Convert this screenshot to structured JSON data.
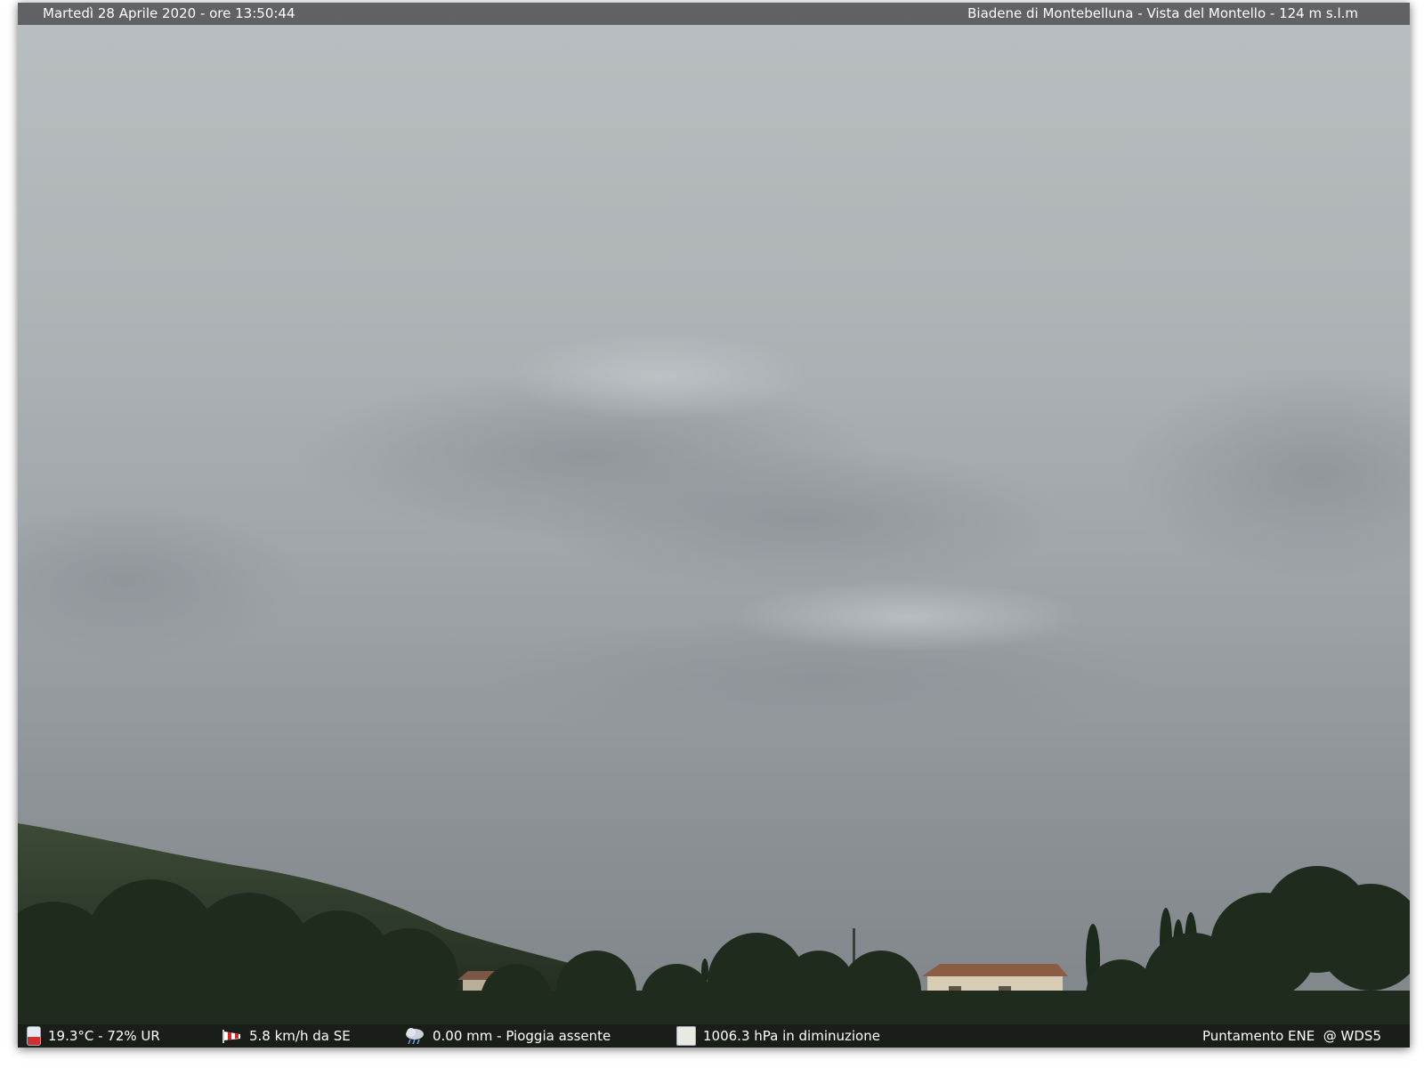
{
  "header": {
    "datetime": "Martedì 28 Aprile 2020 - ore 13:50:44",
    "location": "Biadene di Montebelluna - Vista del Montello - 124 m s.l.m"
  },
  "footer": {
    "temperature": "19.3°C - 72% UR",
    "wind": "5.8 km/h da SE",
    "rain": "0.00 mm - Pioggia assente",
    "pressure": "1006.3 hPa in diminuzione",
    "pointing": "Puntamento ENE  @ WDS5"
  },
  "icons": {
    "temperature": "thermometer-icon",
    "wind": "windsock-icon",
    "rain": "rain-cloud-icon",
    "pressure": "barometer-icon"
  }
}
